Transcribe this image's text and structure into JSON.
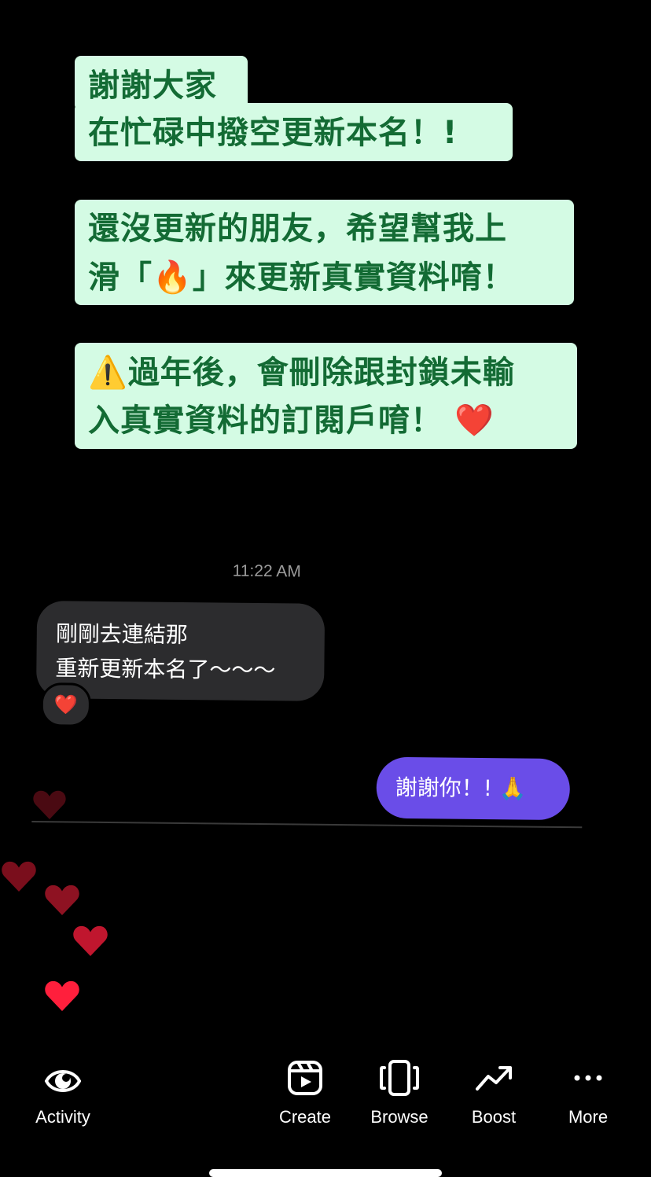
{
  "story": {
    "block1_line1": "謝謝大家",
    "block1_line2": "在忙碌中撥空更新本名！!",
    "block2_line1": "還沒更新的朋友，希望幫我上",
    "block2_line2_pre": "滑「",
    "block2_emoji": "🔥",
    "block2_line2_post": "」來更新真實資料唷！",
    "block3_emoji": "⚠️",
    "block3_line1": "過年後，會刪除跟封鎖未輸",
    "block3_line2": "入真實資料的訂閱戶唷！",
    "block3_heart": "❤️"
  },
  "chat": {
    "time": "11:22 AM",
    "incoming_text": "剛剛去連結那\n重新更新本名了～～～",
    "reaction": "❤️",
    "outgoing_text": "謝謝你！! 🙏"
  },
  "nav": {
    "activity": "Activity",
    "create": "Create",
    "browse": "Browse",
    "boost": "Boost",
    "more": "More"
  },
  "icons": [
    "eye-icon",
    "reels-icon",
    "browse-icon",
    "trending-up-icon",
    "more-dots-icon"
  ],
  "colors": {
    "highlight_bg": "#d4fbe4",
    "highlight_text": "#136b34",
    "outgoing_bubble": "#6a4de8",
    "heart": "#ff1f3c"
  }
}
